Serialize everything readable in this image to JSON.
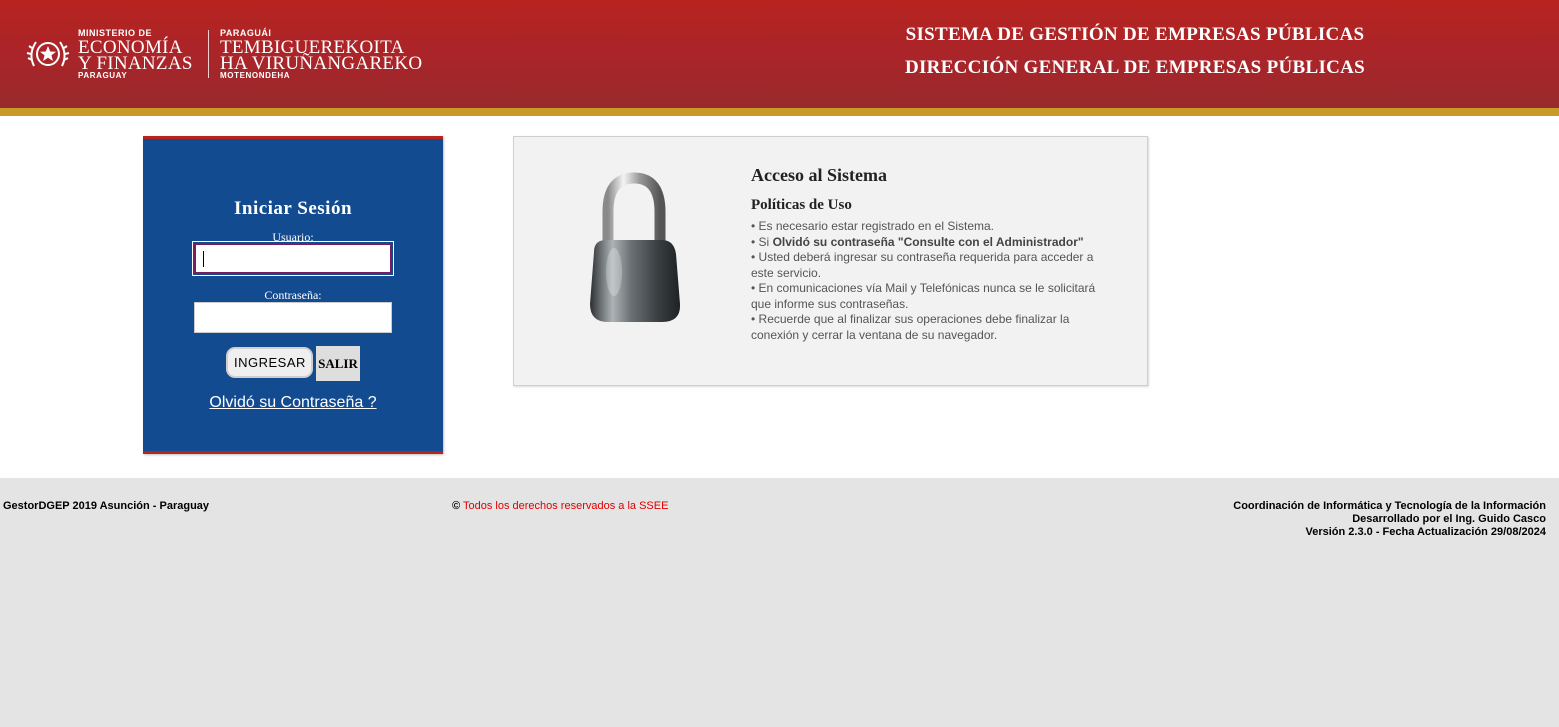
{
  "header": {
    "ministry_small": "MINISTERIO DE",
    "ministry_line1": "ECONOMÍA",
    "ministry_line2": "Y FINANZAS",
    "ministry_country": "PARAGUAY",
    "guarani_small": "PARAGUÁI",
    "guarani_line1": "TEMBIGUEREKOITA",
    "guarani_line2": "HA VIRUÑANGAREKO",
    "guarani_sub": "MOTENONDEHA",
    "system_title_1": "SISTEMA DE GESTIÓN DE EMPRESAS PÚBLICAS",
    "system_title_2": "DIRECCIÓN GENERAL DE EMPRESAS PÚBLICAS",
    "colors": {
      "header_red": "#b7231f",
      "gold_stripe": "#c99a2a"
    }
  },
  "login": {
    "title": "Iniciar Sesión",
    "user_label": "Usuario:",
    "user_value": "",
    "password_label": "Contraseña:",
    "password_value": "",
    "ingresar_label": "INGRESAR",
    "salir_label": "SALIR",
    "forgot_label": "Olvidó su Contraseña ?",
    "colors": {
      "box_blue": "#134b91"
    }
  },
  "info": {
    "icon": "padlock-icon",
    "title": "Acceso al Sistema",
    "subtitle": "Políticas de Uso",
    "policy_1": "Es necesario estar registrado en el Sistema.",
    "policy_2_prefix": "Si",
    "policy_2_bold": "Olvidó su contraseña \"Consulte con el Administrador\"",
    "policy_3": "Usted deberá ingresar su contraseña requerida para acceder a este servicio.",
    "policy_4": "En comunicaciones vía Mail y Telefónicas nunca se le solicitará que informe sus contraseñas.",
    "policy_5": "Recuerde que al finalizar sus operaciones debe finalizar la conexión y cerrar la ventana de su navegador."
  },
  "footer": {
    "left": "GestorDGEP 2019 Asunción - Paraguay",
    "copyright_symbol": "©",
    "rights": "Todos los derechos reservados a la SSEE",
    "right_1": "Coordinación de Informática y Tecnología de la Información",
    "right_2": "Desarrollado por el Ing. Guido Casco",
    "right_3": "Versión 2.3.0 - Fecha Actualización 29/08/2024"
  }
}
